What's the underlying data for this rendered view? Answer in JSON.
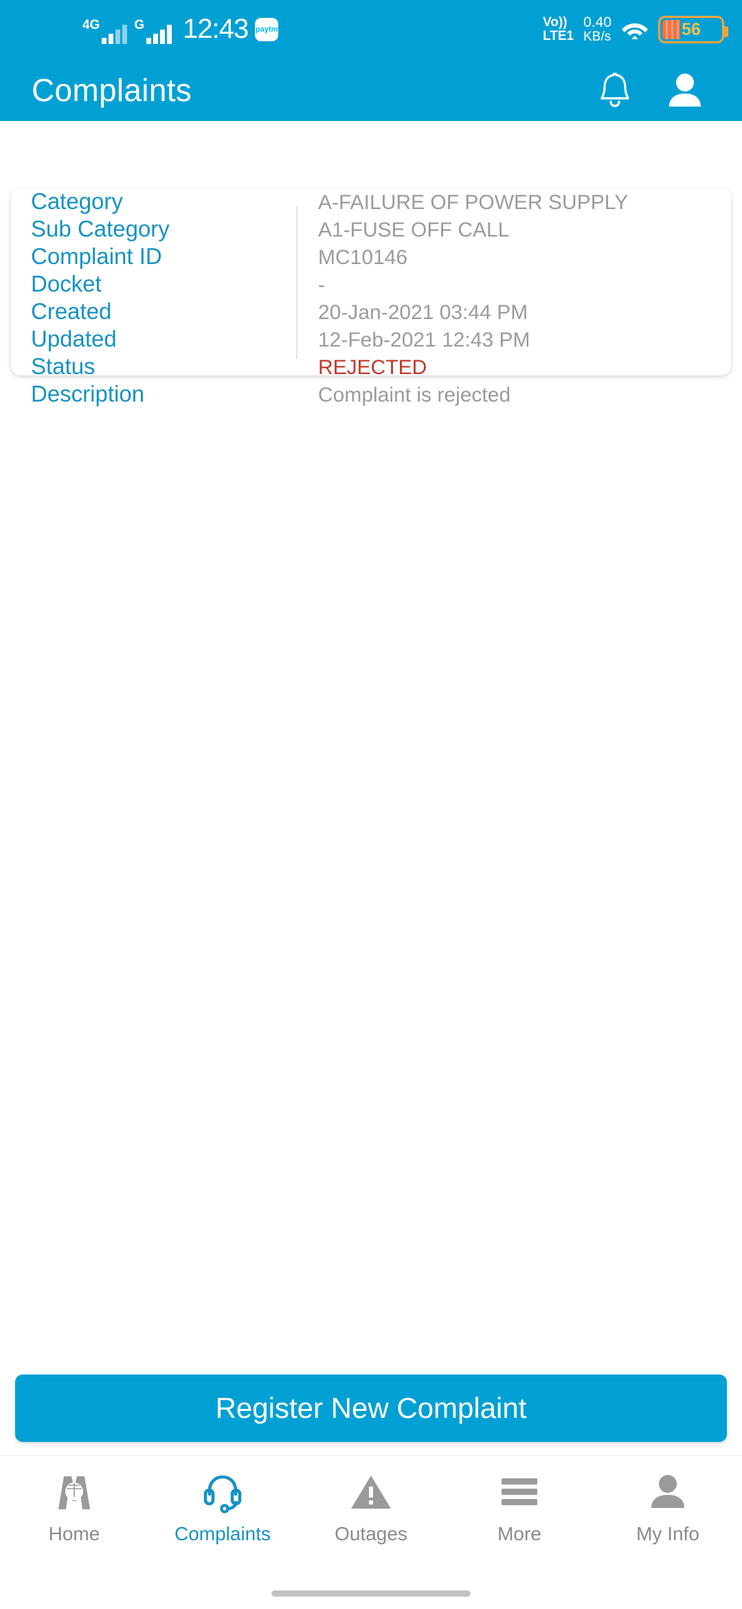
{
  "status_bar": {
    "network_1": "4G",
    "network_2": "G",
    "time": "12:43",
    "app_badge": "paytm",
    "volte_line1": "Vo))",
    "volte_line2": "LTE1",
    "data_rate": "0.40",
    "data_unit": "KB/s",
    "battery_percent": "56"
  },
  "app_bar": {
    "title": "Complaints",
    "notification_icon": "bell-icon",
    "profile_icon": "person-icon"
  },
  "complaint_card": {
    "rows": [
      {
        "label": "Category",
        "value": "A-FAILURE OF POWER SUPPLY",
        "type": "text"
      },
      {
        "label": "Sub Category",
        "value": "A1-FUSE OFF CALL",
        "type": "text"
      },
      {
        "label": "Complaint ID",
        "value": "MC10146",
        "type": "text"
      },
      {
        "label": "Docket",
        "value": "-",
        "type": "text"
      },
      {
        "label": "Created",
        "value": "20-Jan-2021 03:44 PM",
        "type": "text"
      },
      {
        "label": "Updated",
        "value": "12-Feb-2021 12:43 PM",
        "type": "text"
      },
      {
        "label": "Status",
        "value": "REJECTED",
        "type": "status"
      },
      {
        "label": "Description",
        "value": "Complaint is rejected",
        "type": "text"
      }
    ]
  },
  "cta": {
    "label": "Register New Complaint"
  },
  "bottom_nav": {
    "items": [
      {
        "label": "Home",
        "icon": "m-logo-icon",
        "active": false
      },
      {
        "label": "Complaints",
        "icon": "headset-icon",
        "active": true
      },
      {
        "label": "Outages",
        "icon": "warning-triangle-icon",
        "active": false
      },
      {
        "label": "More",
        "icon": "hamburger-icon",
        "active": false
      },
      {
        "label": "My Info",
        "icon": "person-icon",
        "active": false
      }
    ]
  },
  "colors": {
    "brand_blue": "#01A0D4",
    "label_blue": "#1792C4",
    "value_gray": "#9b9b9b",
    "status_red": "#C0392B",
    "nav_gray": "#8a8a8a"
  }
}
